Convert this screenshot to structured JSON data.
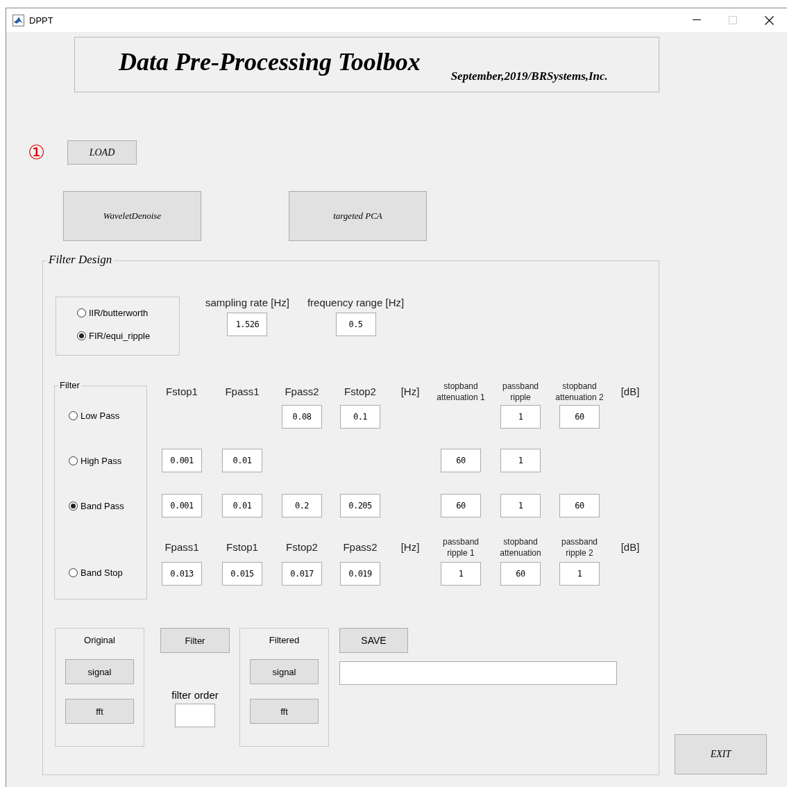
{
  "window": {
    "title": "DPPT"
  },
  "header": {
    "title": "Data Pre-Processing Toolbox",
    "subtitle": "September,2019/BRSystems,Inc."
  },
  "step_marker": "①",
  "load_button": "LOAD",
  "tool_buttons": [
    "WaveletDenoise",
    "targeted PCA"
  ],
  "filter_design": {
    "title": "Filter Design",
    "design_types": [
      {
        "label": "IIR/butterworth",
        "selected": false
      },
      {
        "label": "FIR/equi_ripple",
        "selected": true
      }
    ],
    "sampling_rate": {
      "label": "sampling rate",
      "unit": "[Hz]",
      "value": "1.526"
    },
    "frequency_range": {
      "label": "frequency range",
      "unit": "[Hz]",
      "value": "0.5"
    },
    "filter_group": {
      "title": "Filter",
      "types": [
        {
          "label": "Low Pass",
          "selected": false
        },
        {
          "label": "High Pass",
          "selected": false
        },
        {
          "label": "Band Pass",
          "selected": true
        },
        {
          "label": "Band Stop",
          "selected": false
        }
      ]
    },
    "headers": [
      {
        "freq_labels": [
          "Fstop1",
          "Fpass1",
          "Fpass2",
          "Fstop2"
        ],
        "freq_unit": "[Hz]",
        "db_labels": [
          "stopband\nattenuation 1",
          "passband\nripple",
          "stopband\nattenuation 2"
        ],
        "db_unit": "[dB]"
      },
      {
        "freq_labels": [
          "Fpass1",
          "Fstop1",
          "Fstop2",
          "Fpass2"
        ],
        "freq_unit": "[Hz]",
        "db_labels": [
          "passband\nripple 1",
          "stopband\nattenuation",
          "passband\nripple 2"
        ],
        "db_unit": "[dB]"
      }
    ],
    "rows": [
      {
        "hz_3": "0.08",
        "hz_4": "0.1",
        "db_2": "1",
        "db_3": "60"
      },
      {
        "hz_1": "0.001",
        "hz_2": "0.01",
        "db_1": "60",
        "db_2": "1"
      },
      {
        "hz_1": "0.001",
        "hz_2": "0.01",
        "hz_3": "0.2",
        "hz_4": "0.205",
        "db_1": "60",
        "db_2": "1",
        "db_3": "60"
      },
      {
        "hz_1": "0.013",
        "hz_2": "0.015",
        "hz_3": "0.017",
        "hz_4": "0.019",
        "db_1": "1",
        "db_2": "60",
        "db_3": "1"
      }
    ],
    "original_panel": {
      "title": "Original",
      "buttons": [
        "signal",
        "fft"
      ]
    },
    "filter_button": "Filter",
    "filter_order": {
      "label": "filter order"
    },
    "filtered_panel": {
      "title": "Filtered",
      "buttons": [
        "signal",
        "fft"
      ]
    },
    "save_button": "SAVE"
  },
  "exit_button": "EXIT"
}
